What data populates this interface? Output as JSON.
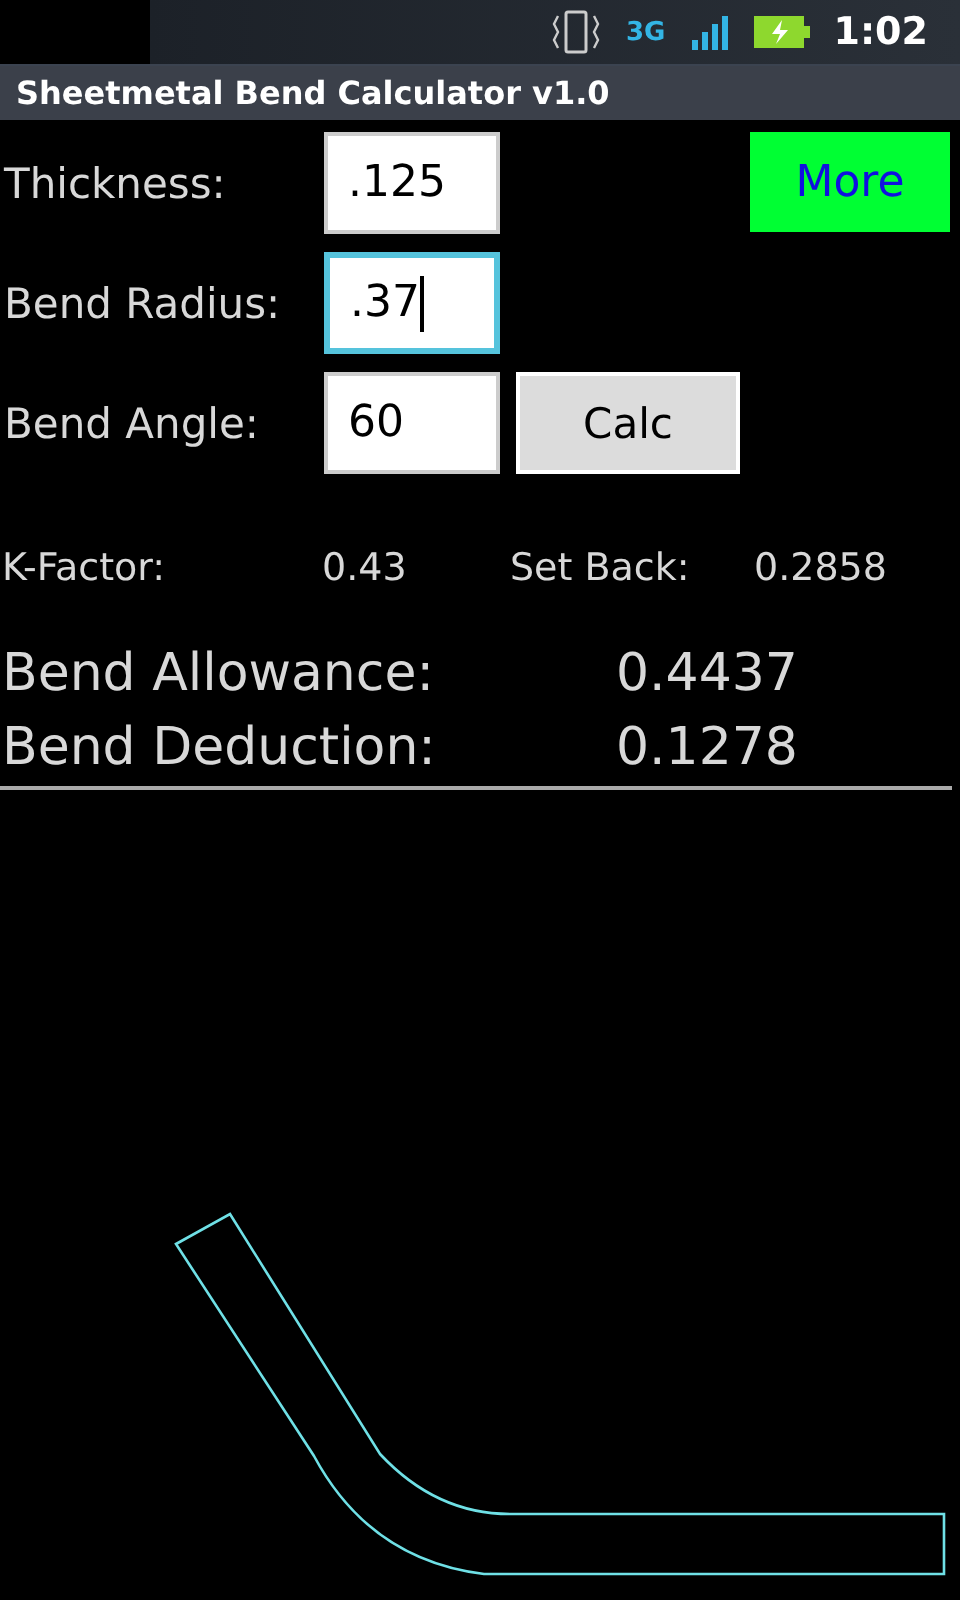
{
  "status_bar": {
    "network": "3G",
    "time": "1:02"
  },
  "window": {
    "title": "Sheetmetal Bend Calculator v1.0"
  },
  "inputs": [
    {
      "label": "Thickness:",
      "value": ".125",
      "focused": false
    },
    {
      "label": "Bend Radius:",
      "value": ".37",
      "focused": true
    },
    {
      "label": "Bend Angle:",
      "value": "60",
      "focused": false
    }
  ],
  "buttons": {
    "more": "More",
    "calc": "Calc"
  },
  "small_results": [
    {
      "label": "K-Factor:",
      "value": "0.43"
    },
    {
      "label": "Set Back:",
      "value": "0.2858"
    }
  ],
  "results": [
    {
      "label": "Bend Allowance:",
      "value": "0.4437"
    },
    {
      "label": "Bend Deduction:",
      "value": "0.1278"
    }
  ]
}
